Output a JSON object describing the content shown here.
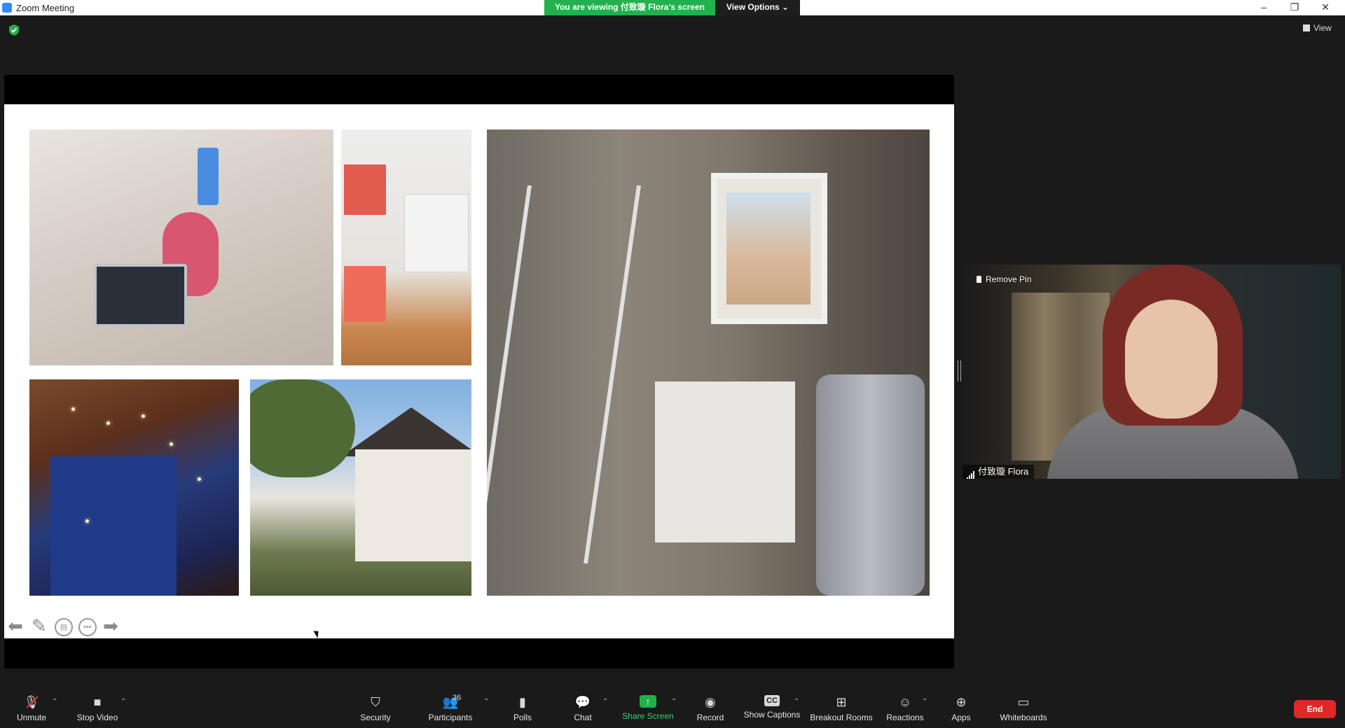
{
  "window": {
    "title": "Zoom Meeting",
    "minimize": "–",
    "restore": "❐",
    "close": "✕"
  },
  "banner": {
    "viewing_text": "You are viewing 付致璇 Flora's screen",
    "view_options_label": "View Options ⌄"
  },
  "top_right": {
    "view_label": "View"
  },
  "share": {
    "slide_photos": [
      "desk-photo",
      "shelf-photo",
      "room-photo",
      "night-photo",
      "house-photo"
    ],
    "annotation_tools": [
      "arrow-left-icon",
      "pen-icon",
      "image-icon",
      "more-icon",
      "arrow-right-icon"
    ]
  },
  "video": {
    "remove_pin_label": "Remove Pin",
    "participant_name": "付致璇 Flora"
  },
  "toolbar": {
    "unmute": "Unmute",
    "stop_video": "Stop Video",
    "security": "Security",
    "participants": "Participants",
    "participants_count": "36",
    "polls": "Polls",
    "chat": "Chat",
    "share_screen": "Share Screen",
    "record": "Record",
    "show_captions": "Show Captions",
    "captions_icon_text": "CC",
    "breakout_rooms": "Breakout Rooms",
    "reactions": "Reactions",
    "apps": "Apps",
    "whiteboards": "Whiteboards",
    "end": "End"
  },
  "colors": {
    "banner_green": "#22b14c",
    "share_green": "#1fb24a",
    "end_red": "#e02828",
    "background": "#1a1a1a"
  }
}
